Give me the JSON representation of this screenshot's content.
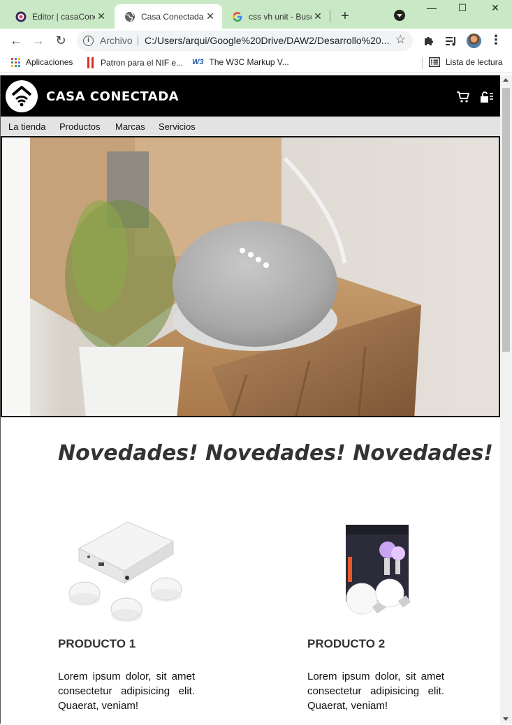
{
  "browser": {
    "tabs": [
      {
        "title": "Editor | casaCone",
        "active": false,
        "favicon": "editor-logo-icon"
      },
      {
        "title": "Casa Conectada",
        "active": true,
        "favicon": "globe-icon"
      },
      {
        "title": "css vh unit - Busc",
        "active": false,
        "favicon": "google-g-icon"
      }
    ],
    "new_tab": "+",
    "address": {
      "scheme_label": "Archivo",
      "url": "C:/Users/arqui/Google%20Drive/DAW2/Desarrollo%20..."
    },
    "bookmarks": [
      {
        "label": "Aplicaciones",
        "icon": "apps-grid-icon"
      },
      {
        "label": "Patron para el NIF e...",
        "icon": "bookmark-red-icon"
      },
      {
        "label": "The W3C Markup V...",
        "icon": "w3c-icon"
      }
    ],
    "reading_list": "Lista de lectura"
  },
  "site": {
    "title": "CASA CONECTADA",
    "nav": [
      "La tienda",
      "Productos",
      "Marcas",
      "Servicios"
    ],
    "banner_text": "Novedades! Novedades! Novedades! Novedades!",
    "products": [
      {
        "name": "PRODUCTO 1",
        "description": "Lorem ipsum dolor, sit amet consectetur adipisicing elit. Quaerat, veniam!",
        "image": "hub-and-buttons-image"
      },
      {
        "name": "PRODUCTO 2",
        "description": "Lorem ipsum dolor, sit amet consectetur adipisicing elit. Quaerat, veniam!",
        "image": "smart-bulbs-box-image"
      }
    ]
  },
  "colors": {
    "tabbar": "#c9e8c5",
    "header": "#000000",
    "nav": "#e3e3e3"
  }
}
